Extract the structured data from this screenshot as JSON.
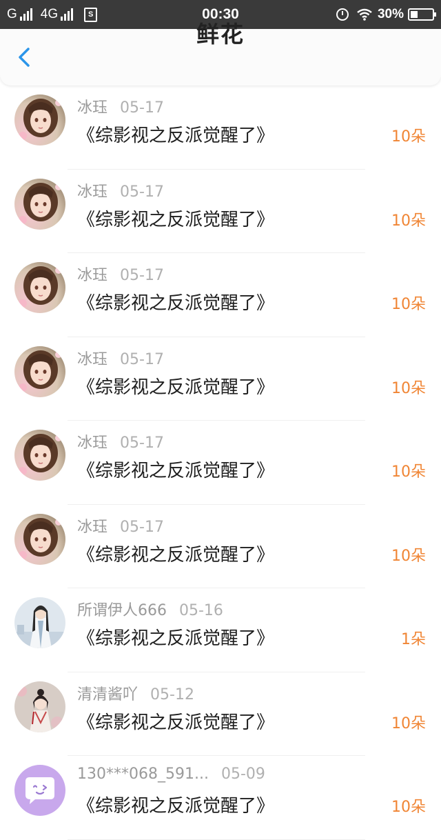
{
  "status_bar": {
    "carrier1": "G",
    "carrier2": "4G",
    "sim_label": "S",
    "time": "00:30",
    "battery": "30%"
  },
  "header": {
    "title": "鲜花",
    "back_icon": "chevron-left-icon",
    "accent": "#2b95e9"
  },
  "colors": {
    "amount": "#f08534",
    "name": "#9a9a9a",
    "book": "#1e1e1e"
  },
  "items": [
    {
      "user": "冰珏",
      "date": "05-17",
      "book": "《综影视之反派觉醒了》",
      "amount": "10朵",
      "avatar": "girl-avatar"
    },
    {
      "user": "冰珏",
      "date": "05-17",
      "book": "《综影视之反派觉醒了》",
      "amount": "10朵",
      "avatar": "girl-avatar"
    },
    {
      "user": "冰珏",
      "date": "05-17",
      "book": "《综影视之反派觉醒了》",
      "amount": "10朵",
      "avatar": "girl-avatar"
    },
    {
      "user": "冰珏",
      "date": "05-17",
      "book": "《综影视之反派觉醒了》",
      "amount": "10朵",
      "avatar": "girl-avatar"
    },
    {
      "user": "冰珏",
      "date": "05-17",
      "book": "《综影视之反派觉醒了》",
      "amount": "10朵",
      "avatar": "girl-avatar"
    },
    {
      "user": "冰珏",
      "date": "05-17",
      "book": "《综影视之反派觉醒了》",
      "amount": "10朵",
      "avatar": "girl-avatar"
    },
    {
      "user": "所谓伊人666",
      "date": "05-16",
      "book": "《综影视之反派觉醒了》",
      "amount": "1朵",
      "avatar": "man-avatar"
    },
    {
      "user": "清清酱吖",
      "date": "05-12",
      "book": "《综影视之反派觉醒了》",
      "amount": "10朵",
      "avatar": "hanfu-avatar"
    },
    {
      "user": "130***068_591...",
      "date": "05-09",
      "book": "《综影视之反派觉醒了》",
      "amount": "10朵",
      "avatar": "chat-bubble-avatar"
    }
  ]
}
